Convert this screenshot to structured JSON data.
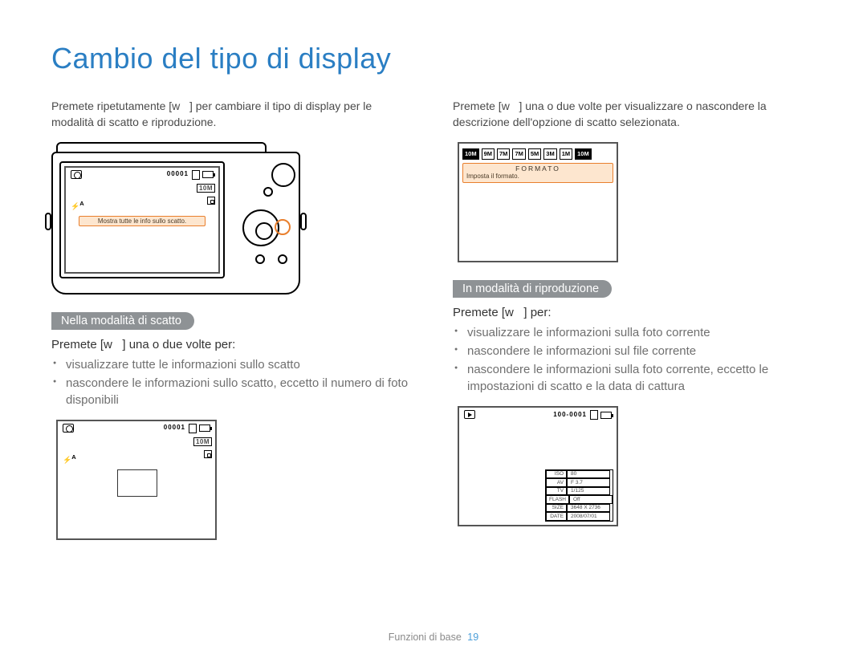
{
  "title": "Cambio del tipo di display",
  "intro_left": "Premete ripetutamente [w   ] per cambiare il tipo di display per le modalità di scatto e riproduzione.",
  "intro_right": "Premete [w   ] una o due volte per visualizzare o nascondere la descrizione dell'opzione di scatto selezionata.",
  "camera_lcd": {
    "counter": "00001",
    "size_tag": "10M",
    "flash_label": "A",
    "tooltip": "Mostra tutte le info sullo scatto."
  },
  "fmt": {
    "items": [
      "10M",
      "9M",
      "7M",
      "7M",
      "5M",
      "3M",
      "1M",
      "10M"
    ],
    "selected_index": 0,
    "highlight_last": true,
    "tooltip_title": "FORMATO",
    "tooltip_text": "Imposta il formato."
  },
  "left_section": {
    "header": "Nella modalità di scatto",
    "lead_prefix": "Premete ",
    "lead_button": "w",
    "lead_suffix": " una o due volte per:",
    "bullets": [
      "visualizzare tutte le informazioni sullo scatto",
      "nascondere le informazioni sullo scatto, eccetto il numero di foto disponibili"
    ]
  },
  "preview_lcd": {
    "counter": "00001",
    "size_tag": "10M",
    "flash_label": "A"
  },
  "right_section": {
    "header": "In modalità di riproduzione",
    "lead_prefix": "Premete ",
    "lead_button": "w",
    "lead_suffix": " per:",
    "bullets": [
      "visualizzare le informazioni sulla foto corrente",
      "nascondere le informazioni sul file corrente",
      "nascondere le informazioni sulla foto corrente, eccetto le impostazioni di scatto e la data di cattura"
    ]
  },
  "play_lcd": {
    "counter": "100-0001",
    "info": [
      {
        "k": "ISO",
        "v": "80"
      },
      {
        "k": "AV",
        "v": "F 3.7"
      },
      {
        "k": "TV",
        "v": "1/125"
      },
      {
        "k": "FLASH",
        "v": "Off"
      },
      {
        "k": "SIZE",
        "v": "3648 X 2736"
      },
      {
        "k": "DATE",
        "v": "2008/07/01"
      }
    ]
  },
  "footer": {
    "label": "Funzioni di base",
    "page": "19"
  }
}
